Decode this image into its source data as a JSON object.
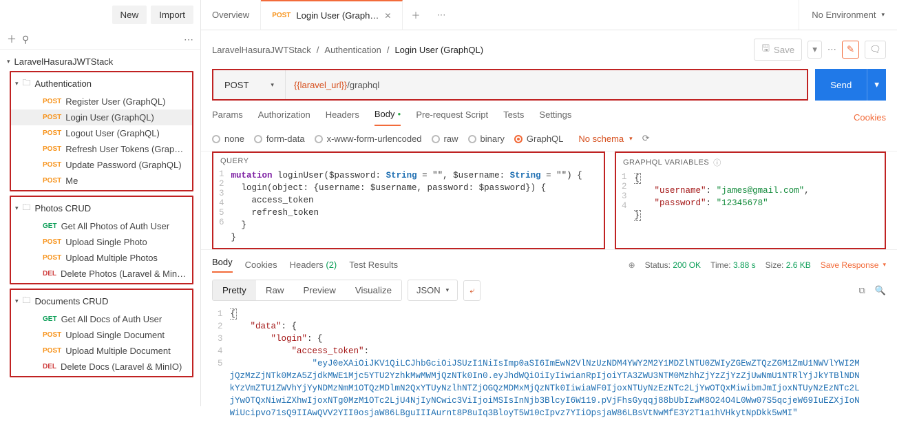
{
  "sidebar": {
    "new_label": "New",
    "import_label": "Import",
    "collection": "LaravelHasuraJWTStack",
    "groups": [
      {
        "name": "Authentication",
        "items": [
          {
            "method": "POST",
            "label": "Register User (GraphQL)"
          },
          {
            "method": "POST",
            "label": "Login User (GraphQL)",
            "selected": true
          },
          {
            "method": "POST",
            "label": "Logout User (GraphQL)"
          },
          {
            "method": "POST",
            "label": "Refresh User Tokens (Graph…"
          },
          {
            "method": "POST",
            "label": "Update Password (GraphQL)"
          },
          {
            "method": "POST",
            "label": "Me"
          }
        ]
      },
      {
        "name": "Photos CRUD",
        "items": [
          {
            "method": "GET",
            "label": "Get All Photos of Auth User"
          },
          {
            "method": "POST",
            "label": "Upload Single Photo"
          },
          {
            "method": "POST",
            "label": "Upload Multiple Photos"
          },
          {
            "method": "DEL",
            "label": "Delete Photos (Laravel & MinI…"
          }
        ]
      },
      {
        "name": "Documents CRUD",
        "items": [
          {
            "method": "GET",
            "label": "Get All Docs of Auth User"
          },
          {
            "method": "POST",
            "label": "Upload Single Document"
          },
          {
            "method": "POST",
            "label": "Upload Multiple Document"
          },
          {
            "method": "DEL",
            "label": "Delete Docs (Laravel & MinIO)"
          }
        ]
      }
    ]
  },
  "tabs": {
    "overview": "Overview",
    "active": {
      "method": "POST",
      "label": "Login User (Graph…"
    },
    "env": "No Environment"
  },
  "crumbs": {
    "a": "LaravelHasuraJWTStack",
    "b": "Authentication",
    "c": "Login User (GraphQL)",
    "save": "Save"
  },
  "request": {
    "method": "POST",
    "url_var": "{{laravel_url}}",
    "url_path": "/graphql",
    "send": "Send"
  },
  "subtabs": {
    "params": "Params",
    "auth": "Authorization",
    "headers": "Headers",
    "body": "Body",
    "prereq": "Pre-request Script",
    "tests": "Tests",
    "settings": "Settings",
    "cookies": "Cookies"
  },
  "body_types": {
    "none": "none",
    "form": "form-data",
    "xform": "x-www-form-urlencoded",
    "raw": "raw",
    "binary": "binary",
    "graphql": "GraphQL",
    "noschema": "No schema"
  },
  "query": {
    "title": "QUERY",
    "l1": {
      "kw": "mutation",
      "fn": " loginUser($password: ",
      "t1": "String",
      "mid": " = \"\", $username: ",
      "t2": "String",
      "end": " = \"\") {"
    },
    "l2": "  login(object: {username: $username, password: $password}) {",
    "l3": "    access_token",
    "l4": "    refresh_token",
    "l5": "  }",
    "l6": "}"
  },
  "vars": {
    "title": "GRAPHQL VARIABLES",
    "username_key": "\"username\"",
    "username_val": "\"james@gmail.com\"",
    "password_key": "\"password\"",
    "password_val": "\"12345678\""
  },
  "resp_tabs": {
    "body": "Body",
    "cookies": "Cookies",
    "headers": "Headers",
    "hcount": "(2)",
    "tests": "Test Results"
  },
  "status": {
    "label": "Status:",
    "code": "200 OK",
    "time_label": "Time:",
    "time": "3.88 s",
    "size_label": "Size:",
    "size": "2.6 KB",
    "save": "Save Response"
  },
  "resp_toolbar": {
    "pretty": "Pretty",
    "raw": "Raw",
    "preview": "Preview",
    "visualize": "Visualize",
    "json": "JSON"
  },
  "response": {
    "data_key": "\"data\"",
    "login_key": "\"login\"",
    "at_key": "\"access_token\"",
    "token": "\"eyJ0eXAiOiJKV1QiLCJhbGciOiJSUzI1NiIsImp0aSI6ImEwN2VlNzUzNDM4YWY2M2Y1MDZlNTU0ZWIyZGEwZTQzZGM1ZmU1NWVlYWI2MjQzMzZjNTk0MzA5ZjdkMWE1Mjc5YTU2YzhkMwMWMjQzNTk0In0.eyJhdWQiOiIyIiwianRpIjoiYTA3ZWU3NTM0MzhhZjYzZjYzZjUwNmU1NTRlYjJkYTBlNDNkYzVmZTU1ZWVhYjYyNDMzNmM1OTQzMDlmN2QxYTUyNzlhNTZjOGQzMDMxMjQzNTk0IiwiaWF0IjoxNTUyNzEzNTc2LjYwOTQxMiwibmJmIjoxNTUyNzEzNTc2LjYwOTQxNiwiZXhwIjoxNTg0MzM1OTc2LjU4NjIyNCwic3ViIjoiMSIsInNjb3BlcyI6W119.pVjFhsGyqqj88bUbIzwM8O24O4L0Ww07S5qcjeW69IuEZXjIoNWiUcipvo71sQ9IIAwQVV2YII0osjaW86LBguIIIAurnt8P8uIq3BloyT5W10cIpvz7YIiOpsjaW86LBsVtNwMfE3Y2T1a1hVHkytNpDkk5wMI\""
  }
}
